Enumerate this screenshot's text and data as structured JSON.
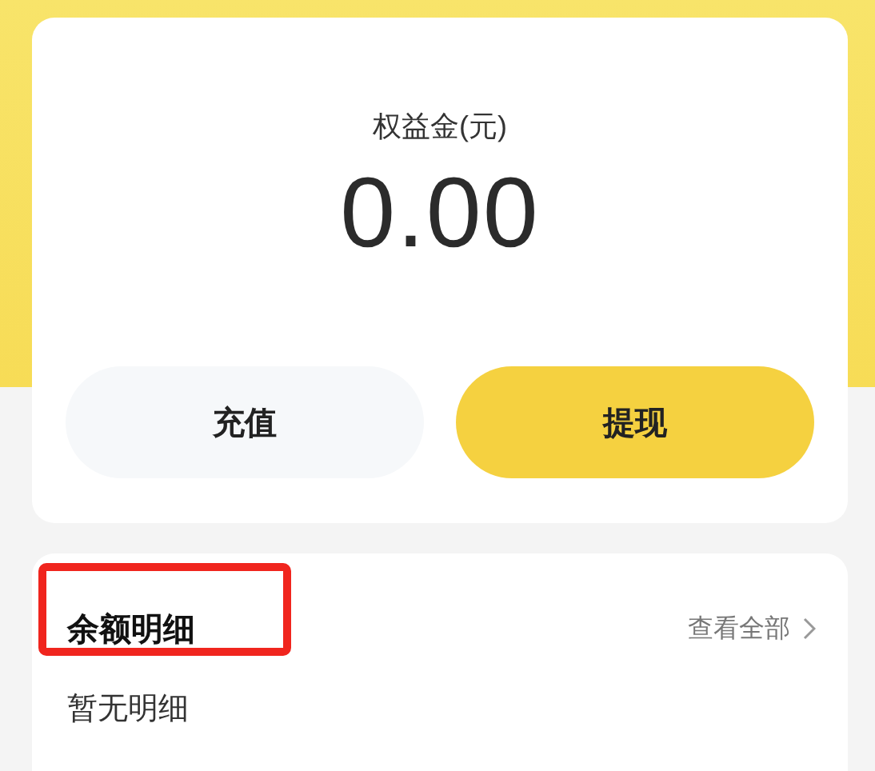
{
  "balance": {
    "label": "权益金(元)",
    "amount": "0.00"
  },
  "buttons": [
    {
      "label": "充值",
      "kind": "secondary"
    },
    {
      "label": "提现",
      "kind": "primary"
    }
  ],
  "details": {
    "title": "余额明细",
    "title_highlighted": true,
    "view_all": "查看全部",
    "empty_text": "暂无明细"
  }
}
